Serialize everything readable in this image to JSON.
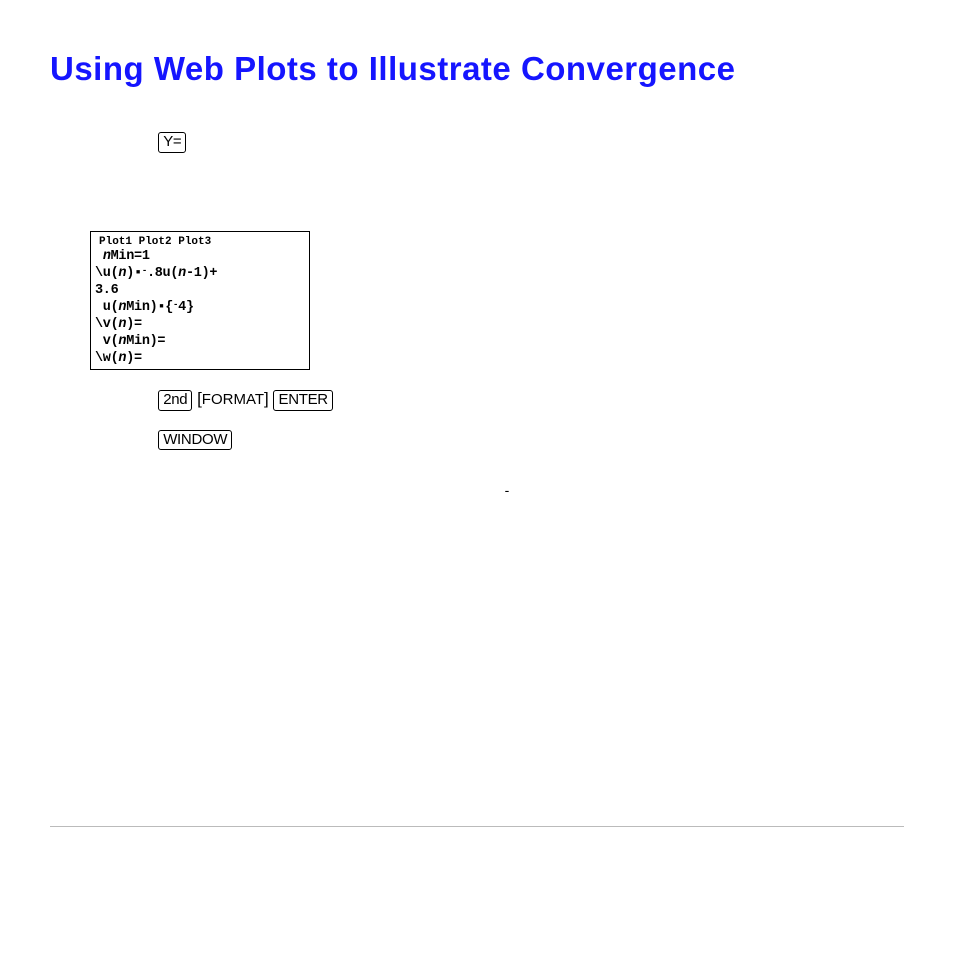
{
  "title": "Using Web Plots to Illustrate Convergence",
  "keys": {
    "y_equals": "Y=",
    "second": "2nd",
    "format": "FORMAT",
    "enter": "ENTER",
    "window": "WINDOW"
  },
  "calc": {
    "header": "Plot1 Plot2 Plot3",
    "line1": " nMin=1",
    "line2": "\\u(n)▪-.8u(n-1)+",
    "line3": "3.6",
    "line4": " u(nMin)▪{-4}",
    "line5": "\\v(n)=",
    "line6": " v(nMin)=",
    "line7": "\\w(n)="
  }
}
